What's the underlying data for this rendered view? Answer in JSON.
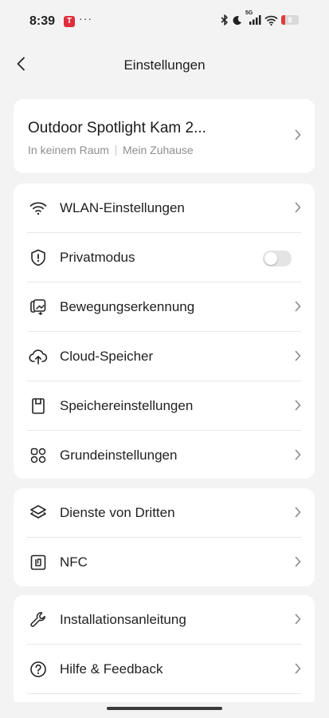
{
  "status_bar": {
    "time": "8:39",
    "app_badge": "T",
    "more": "···",
    "network": "5G",
    "battery": "8",
    "battery_color": "#e23b3b"
  },
  "header": {
    "title": "Einstellungen",
    "back_icon": "chevron-left-icon"
  },
  "device": {
    "name": "Outdoor Spotlight Kam 2...",
    "room": "In keinem Raum",
    "home": "Mein Zuhause"
  },
  "groups": [
    {
      "items": [
        {
          "label": "WLAN-Einstellungen",
          "icon": "wifi-icon",
          "control": "chevron"
        },
        {
          "label": "Privatmodus",
          "icon": "shield-icon",
          "control": "toggle",
          "toggle_on": false
        },
        {
          "label": "Bewegungserkennung",
          "icon": "motion-detection-icon",
          "control": "chevron"
        },
        {
          "label": "Cloud-Speicher",
          "icon": "cloud-upload-icon",
          "control": "chevron"
        },
        {
          "label": "Speichereinstellungen",
          "icon": "sd-card-icon",
          "control": "chevron"
        },
        {
          "label": "Grundeinstellungen",
          "icon": "grid-icon",
          "control": "chevron"
        }
      ]
    },
    {
      "items": [
        {
          "label": "Dienste von Dritten",
          "icon": "layers-icon",
          "control": "chevron"
        },
        {
          "label": "NFC",
          "icon": "nfc-icon",
          "control": "chevron"
        }
      ]
    },
    {
      "items": [
        {
          "label": "Installationsanleitung",
          "icon": "wrench-icon",
          "control": "chevron"
        },
        {
          "label": "Hilfe & Feedback",
          "icon": "help-icon",
          "control": "chevron"
        }
      ]
    }
  ],
  "colors": {
    "background": "#f3f3f3",
    "card": "#ffffff",
    "text": "#1f1f1f",
    "secondary_text": "#8e8e8e",
    "toggle_off": "#e4e4e4"
  }
}
